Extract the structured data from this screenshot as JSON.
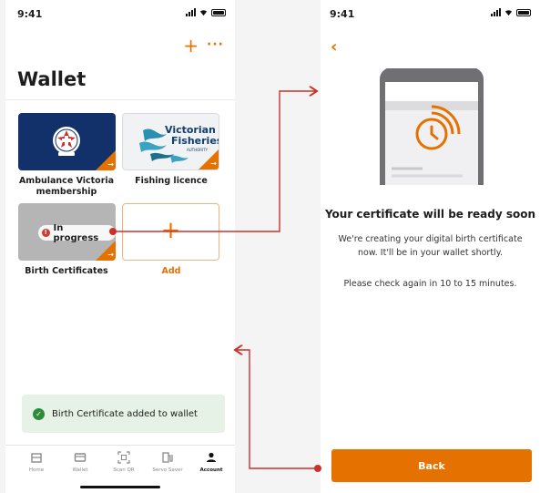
{
  "colors": {
    "accent": "#e57200",
    "connector": "#c8322b",
    "success": "#2e8b3a",
    "ambulance_navy": "#12306a"
  },
  "left_screen": {
    "status_time": "9:41",
    "title": "Wallet",
    "top_actions": {
      "add": "+",
      "more": "···"
    },
    "cards": [
      {
        "label": "Ambulance Victoria membership",
        "icon": "ambulance-victoria-logo"
      },
      {
        "label": "Fishing licence",
        "logo_text_1": "Victorian",
        "logo_text_2": "Fisheries",
        "logo_text_3": "AUTHORITY",
        "icon": "fisheries-logo"
      },
      {
        "label": "Birth Certificates",
        "badge": "In progress",
        "icon": "birth-certificate-card"
      },
      {
        "label": "Add",
        "icon": "plus-icon"
      }
    ],
    "toast": "Birth Certificate added to wallet",
    "tabs": [
      {
        "label": "Home",
        "icon": "home-icon"
      },
      {
        "label": "Wallet",
        "icon": "wallet-icon"
      },
      {
        "label": "Scan QR",
        "icon": "qr-scan-icon"
      },
      {
        "label": "Servo Saver",
        "icon": "fuel-icon"
      },
      {
        "label": "Account",
        "icon": "account-icon",
        "active": true
      }
    ]
  },
  "right_screen": {
    "status_time": "9:41",
    "title": "Your certificate will be ready soon",
    "body_1": "We're creating your digital birth certificate now. It'll be in your wallet shortly.",
    "body_2": "Please check again in 10 to 15 minutes.",
    "back_button": "Back"
  }
}
